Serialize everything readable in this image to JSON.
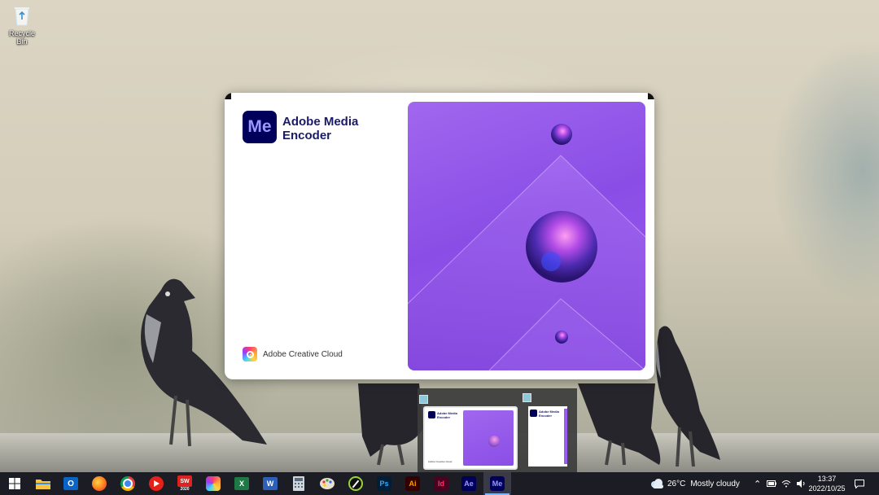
{
  "desktop": {
    "recycle_bin_label": "Recycle Bin"
  },
  "splash": {
    "logo_text": "Me",
    "app_name": "Adobe Media Encoder",
    "creative_cloud_label": "Adobe Creative Cloud",
    "brand_color": "#00005b",
    "art_color": "#9a5cf0"
  },
  "thumbnails": [
    {
      "name": "Adobe Media Encoder",
      "footer": "Adobe Creative Cloud"
    },
    {
      "name": "Adobe Media Encoder",
      "footer": ""
    }
  ],
  "taskbar": {
    "icons": [
      "start-icon",
      "file-explorer-icon",
      "outlook-icon",
      "firefox-icon",
      "chrome-icon",
      "youtube-icon",
      "solidworks-icon",
      "creative-cloud-icon",
      "excel-icon",
      "word-icon",
      "calculator-icon",
      "paint-icon",
      "inkscape-icon",
      "photoshop-icon",
      "illustrator-icon",
      "indesign-icon",
      "after-effects-icon",
      "media-encoder-icon"
    ],
    "labels": {
      "excel": "X",
      "word": "W",
      "photoshop": "Ps",
      "illustrator": "Ai",
      "indesign": "Id",
      "after_effects": "Ae",
      "media_encoder": "Me",
      "solidworks": "SW",
      "solidworks_year": "2020"
    },
    "weather_temp": "26°C",
    "weather_desc": "Mostly cloudy",
    "time": "13:37",
    "date": "2022/10/25"
  }
}
